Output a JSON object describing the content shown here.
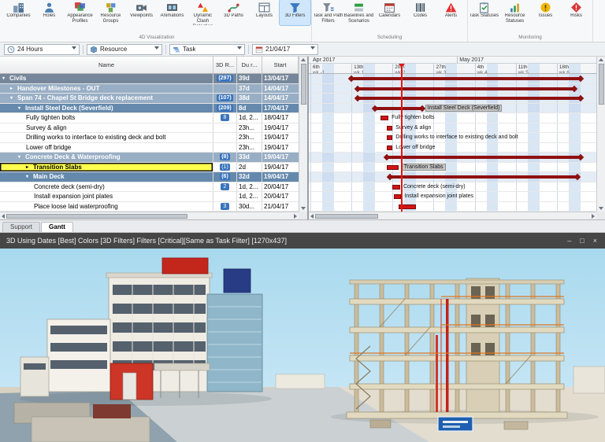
{
  "ribbon": {
    "groups": [
      {
        "label": "4D Visualization",
        "items": [
          {
            "label": "Companies",
            "icon": "companies-icon"
          },
          {
            "label": "Roles",
            "icon": "roles-icon"
          },
          {
            "label": "Appearance Profiles",
            "icon": "appearance-profiles-icon"
          },
          {
            "label": "Resource Groups",
            "icon": "resource-groups-icon"
          },
          {
            "label": "Viewpoints",
            "icon": "viewpoints-icon"
          },
          {
            "label": "Animations",
            "icon": "animations-icon"
          },
          {
            "label": "Dynamic Clash Detection",
            "icon": "clash-detection-icon"
          },
          {
            "label": "3D Paths",
            "icon": "3d-paths-icon"
          },
          {
            "label": "Layouts",
            "icon": "layouts-icon"
          },
          {
            "label": "3D Filters",
            "icon": "3d-filters-icon",
            "selected": true
          }
        ]
      },
      {
        "label": "Scheduling",
        "items": [
          {
            "label": "Task and Path Filters",
            "icon": "task-path-filters-icon"
          },
          {
            "label": "Baselines and Scenarios",
            "icon": "baselines-icon"
          },
          {
            "label": "Calendars",
            "icon": "calendars-icon"
          },
          {
            "label": "Codes",
            "icon": "codes-icon"
          },
          {
            "label": "Alerts",
            "icon": "alerts-icon"
          }
        ]
      },
      {
        "label": "Monitoring",
        "items": [
          {
            "label": "Task Statuses",
            "icon": "task-statuses-icon"
          },
          {
            "label": "Resource Statuses",
            "icon": "resource-statuses-icon"
          },
          {
            "label": "Issues",
            "icon": "issues-icon"
          },
          {
            "label": "Risks",
            "icon": "risks-icon"
          }
        ]
      }
    ]
  },
  "filter_bar": {
    "fields": [
      {
        "value": "24 Hours",
        "icon": "clock-icon"
      },
      {
        "value": "Resource",
        "icon": "resource-icon"
      },
      {
        "value": "Task",
        "icon": "task-icon"
      }
    ],
    "date_value": "21/04/17"
  },
  "task_table": {
    "columns": [
      "Name",
      "3D R...",
      "Du r...",
      "Start"
    ],
    "rows": [
      {
        "name": "Civils",
        "level": 0,
        "style": "dark",
        "arrow": "expanded",
        "res": "(297)",
        "dur": "39d",
        "start": "13/04/17",
        "bar": {
          "kind": "summary",
          "start": 7,
          "dur": 39
        }
      },
      {
        "name": "Handover Milestones - OUT",
        "level": 1,
        "style": "mid",
        "arrow": "collapsed",
        "res": "",
        "dur": "37d",
        "start": "14/04/17",
        "bar": {
          "kind": "summary",
          "start": 8,
          "dur": 37
        }
      },
      {
        "name": "Span 74 - Chapel St Bridge deck replacement",
        "level": 1,
        "style": "mid",
        "arrow": "expanded",
        "res": "(107)",
        "dur": "38d",
        "start": "14/04/17",
        "bar": {
          "kind": "summary",
          "start": 8,
          "dur": 38
        }
      },
      {
        "name": "Install Steel Deck (Severfield)",
        "level": 2,
        "style": "blue",
        "arrow": "expanded",
        "res": "(209)",
        "dur": "8d",
        "start": "17/04/17",
        "bar": {
          "kind": "summary",
          "start": 11,
          "dur": 8,
          "label": "Install Steel Deck (Severfield)",
          "label_highlight": true
        }
      },
      {
        "name": "Fully tighten bolts",
        "level": 3,
        "style": "task",
        "arrow": null,
        "res": "8",
        "dur": "1d, 2...",
        "start": "18/04/17",
        "bar": {
          "kind": "task",
          "start": 12,
          "dur": 1.3,
          "label": "Fully tighten bolts"
        }
      },
      {
        "name": "Survey & align",
        "level": 3,
        "style": "task",
        "arrow": null,
        "res": "",
        "dur": "23h...",
        "start": "19/04/17",
        "bar": {
          "kind": "task",
          "start": 13,
          "dur": 1,
          "label": "Survey & align"
        }
      },
      {
        "name": "Drilling works to interface to existing deck and bolt",
        "level": 3,
        "style": "task",
        "arrow": null,
        "res": "",
        "dur": "23h...",
        "start": "19/04/17",
        "bar": {
          "kind": "task",
          "start": 13,
          "dur": 1,
          "label": "Drilling works to interface to existing deck and bolt"
        }
      },
      {
        "name": "Lower off bridge",
        "level": 3,
        "style": "task",
        "arrow": null,
        "res": "",
        "dur": "23h...",
        "start": "19/04/17",
        "bar": {
          "kind": "task",
          "start": 13,
          "dur": 1,
          "label": "Lower off bridge"
        }
      },
      {
        "name": "Concrete Deck & Waterproofing",
        "level": 2,
        "style": "mid",
        "arrow": "expanded",
        "res": "(8)",
        "dur": "33d",
        "start": "19/04/17",
        "bar": {
          "kind": "summary",
          "start": 13,
          "dur": 33
        }
      },
      {
        "name": "Transition Slabs",
        "level": 3,
        "style": "selected",
        "arrow": "collapsed",
        "res": "(1)",
        "dur": "2d",
        "start": "19/04/17",
        "bar": {
          "kind": "task",
          "start": 13,
          "dur": 2,
          "label": "Transition Slabs",
          "label_highlight": true
        }
      },
      {
        "name": "Main Deck",
        "level": 3,
        "style": "blue",
        "arrow": "expanded",
        "res": "(6)",
        "dur": "32d",
        "start": "19/04/17",
        "bar": {
          "kind": "summary",
          "start": 13.5,
          "dur": 32
        }
      },
      {
        "name": "Concrete deck (semi-dry)",
        "level": 4,
        "style": "task",
        "arrow": null,
        "res": "2",
        "dur": "1d, 2...",
        "start": "20/04/17",
        "bar": {
          "kind": "task",
          "start": 14,
          "dur": 1.3,
          "label": "Concrete deck (semi-dry)"
        }
      },
      {
        "name": "Install expansion joint plates",
        "level": 4,
        "style": "task",
        "arrow": null,
        "res": "",
        "dur": "1d, 2...",
        "start": "20/04/17",
        "bar": {
          "kind": "task",
          "start": 14.2,
          "dur": 1.3,
          "label": "Install expansion joint plates"
        }
      },
      {
        "name": "Place loose laid waterproofing",
        "level": 4,
        "style": "task",
        "arrow": null,
        "res": "3",
        "dur": "30d...",
        "start": "21/04/17",
        "bar": {
          "kind": "task",
          "start": 15,
          "dur": 3,
          "label": ""
        }
      }
    ]
  },
  "timeline": {
    "months": [
      {
        "label": "Apr 2017",
        "at_day": 0
      },
      {
        "label": "May 2017",
        "at_day": 25
      }
    ],
    "ticks": [
      {
        "day": "6th",
        "week": "wk -1"
      },
      {
        "day": "13th",
        "week": "wk 1"
      },
      {
        "day": "20th",
        "week": "wk 2"
      },
      {
        "day": "27th",
        "week": "wk 3"
      },
      {
        "day": "4th",
        "week": "wk 4"
      },
      {
        "day": "11th",
        "week": "wk 5"
      },
      {
        "day": "18th",
        "week": "wk 6"
      }
    ],
    "current_date_day": 15.5
  },
  "tabs": [
    {
      "label": "Support",
      "active": false
    },
    {
      "label": "Gantt",
      "active": true
    }
  ],
  "viewport": {
    "title": "3D Using Dates [Best] Colors [3D Filters] Filters [Critical][Same as Task Filter] [1270x437]",
    "controls": [
      {
        "name": "minimize-button",
        "glyph": "–"
      },
      {
        "name": "maximize-button",
        "glyph": "□"
      },
      {
        "name": "close-button",
        "glyph": "×"
      }
    ]
  },
  "colors": {
    "summary_bar": "#8f1010",
    "task_bar": "#d01515",
    "current_date_line": "#e31515",
    "selected_row": "#ffff4d",
    "weekend_shade": "#d9e6f4",
    "badge": "#3b74bc",
    "row_dark": "#76879b",
    "row_mid": "#98aec5",
    "row_blue": "#6589ad"
  }
}
